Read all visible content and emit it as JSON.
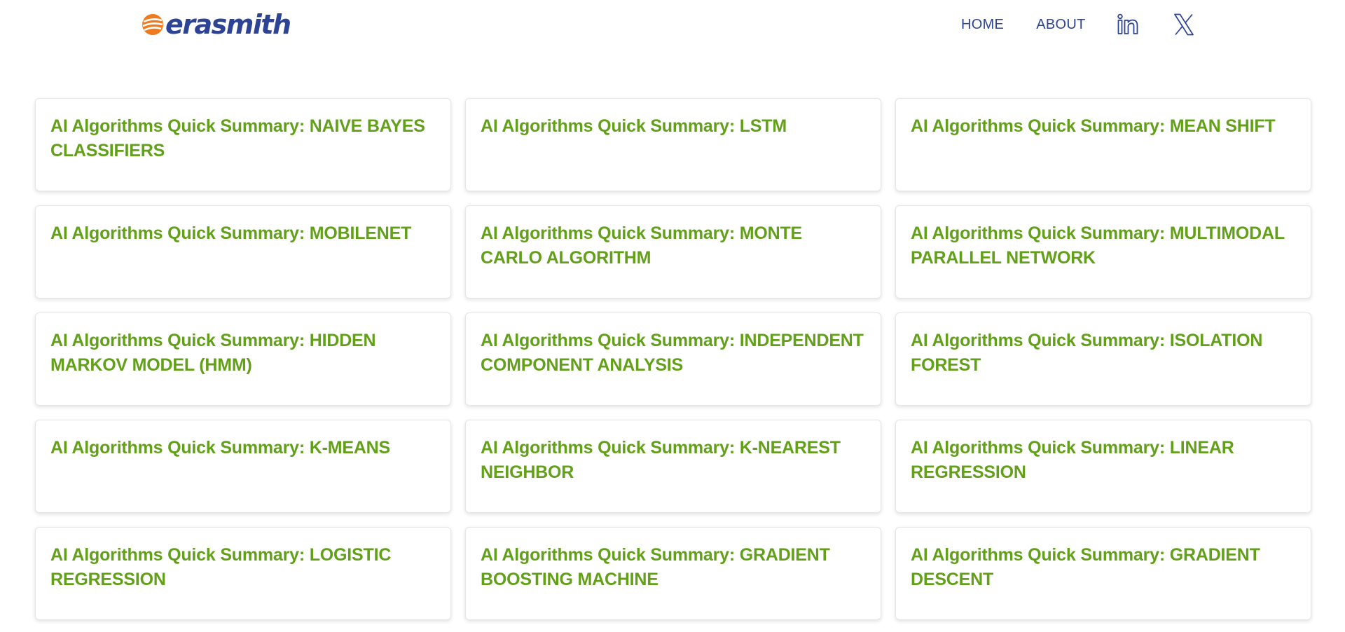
{
  "header": {
    "logo_text": "erasmith",
    "nav": {
      "home_label": "HOME",
      "about_label": "ABOUT"
    },
    "social": [
      {
        "icon": "linkedin-icon"
      },
      {
        "icon": "x-icon"
      }
    ]
  },
  "colors": {
    "brand_blue": "#2d4496",
    "brand_orange": "#f07a1e",
    "title_green": "#63a01a"
  },
  "posts": [
    {
      "title": "AI Algorithms Quick Summary: NAIVE BAYES CLASSIFIERS"
    },
    {
      "title": "AI Algorithms Quick Summary: LSTM"
    },
    {
      "title": "AI Algorithms Quick Summary: MEAN SHIFT"
    },
    {
      "title": "AI Algorithms Quick Summary: MOBILENET"
    },
    {
      "title": "AI Algorithms Quick Summary: MONTE CARLO ALGORITHM"
    },
    {
      "title": "AI Algorithms Quick Summary: MULTIMODAL PARALLEL NETWORK"
    },
    {
      "title": "AI Algorithms Quick Summary: HIDDEN MARKOV MODEL (HMM)"
    },
    {
      "title": "AI Algorithms Quick Summary: INDEPENDENT COMPONENT ANALYSIS"
    },
    {
      "title": "AI Algorithms Quick Summary: ISOLATION FOREST"
    },
    {
      "title": "AI Algorithms Quick Summary: K-MEANS"
    },
    {
      "title": "AI Algorithms Quick Summary: K-NEAREST NEIGHBOR"
    },
    {
      "title": "AI Algorithms Quick Summary: LINEAR REGRESSION"
    },
    {
      "title": "AI Algorithms Quick Summary: LOGISTIC REGRESSION"
    },
    {
      "title": "AI Algorithms Quick Summary: GRADIENT BOOSTING MACHINE"
    },
    {
      "title": "AI Algorithms Quick Summary: GRADIENT DESCENT"
    }
  ]
}
